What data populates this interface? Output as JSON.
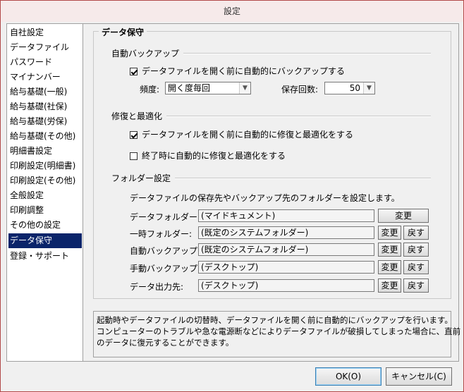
{
  "window": {
    "title": "設定"
  },
  "sidebar": {
    "items": [
      {
        "label": "自社設定"
      },
      {
        "label": "データファイル"
      },
      {
        "label": "パスワード"
      },
      {
        "label": "マイナンバー"
      },
      {
        "label": "給与基礎(一般)"
      },
      {
        "label": "給与基礎(社保)"
      },
      {
        "label": "給与基礎(労保)"
      },
      {
        "label": "給与基礎(その他)"
      },
      {
        "label": "明細書設定"
      },
      {
        "label": "印刷設定(明細書)"
      },
      {
        "label": "印刷設定(その他)"
      },
      {
        "label": "全般設定"
      },
      {
        "label": "印刷調整"
      },
      {
        "label": "その他の設定"
      },
      {
        "label": "データ保守"
      },
      {
        "label": "登録・サポート"
      }
    ],
    "selected_index": 14
  },
  "main": {
    "group_title": "データ保守",
    "auto_backup": {
      "heading": "自動バックアップ",
      "checkbox_label": "データファイルを開く前に自動的にバックアップする",
      "checked": true,
      "frequency_label": "頻度:",
      "frequency_value": "開く度毎回",
      "count_label": "保存回数:",
      "count_value": "50"
    },
    "repair": {
      "heading": "修復と最適化",
      "before_open_label": "データファイルを開く前に自動的に修復と最適化をする",
      "before_open_checked": true,
      "on_exit_label": "終了時に自動的に修復と最適化をする",
      "on_exit_checked": false
    },
    "folders": {
      "heading": "フォルダー設定",
      "description": "データファイルの保存先やバックアップ先のフォルダーを設定します。",
      "change_label": "変更",
      "reset_label": "戻す",
      "rows": [
        {
          "label": "データフォルダー:",
          "value": "(マイドキュメント)"
        },
        {
          "label": "一時フォルダー:",
          "value": "(既定のシステムフォルダー)"
        },
        {
          "label": "自動バックアップ:",
          "value": "(既定のシステムフォルダー)"
        },
        {
          "label": "手動バックアップ:",
          "value": "(デスクトップ)"
        },
        {
          "label": "データ出力先:",
          "value": "(デスクトップ)"
        }
      ]
    }
  },
  "info": {
    "line1": "起動時やデータファイルの切替時、データファイルを開く前に自動的にバックアップを行います。",
    "line2": "コンピューターのトラブルや急な電源断などによりデータファイルが破損してしまった場合に、直前",
    "line3": "のデータに復元することができます。"
  },
  "footer": {
    "ok_label": "OK(O)",
    "cancel_label": "キャンセル(C)"
  }
}
